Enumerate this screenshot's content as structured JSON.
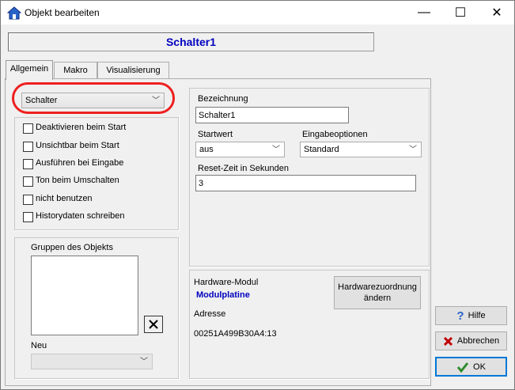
{
  "window": {
    "title": "Objekt bearbeiten"
  },
  "titlebar_buttons": {
    "minimize": "—",
    "maximize": "☐",
    "close": "✕"
  },
  "object_name": "Schalter1",
  "tabs": [
    {
      "label": "Allgemein",
      "active": true
    },
    {
      "label": "Makro",
      "active": false
    },
    {
      "label": "Visualisierung",
      "active": false
    }
  ],
  "type_select": {
    "value": "Schalter"
  },
  "checkboxes": [
    {
      "label": "Deaktivieren beim Start",
      "checked": false
    },
    {
      "label": "Unsichtbar beim Start",
      "checked": false
    },
    {
      "label": "Ausführen bei Eingabe",
      "checked": false
    },
    {
      "label": "Ton beim Umschalten",
      "checked": false
    },
    {
      "label": "nicht benutzen",
      "checked": false
    },
    {
      "label": "Historydaten schreiben",
      "checked": false
    }
  ],
  "groups": {
    "label": "Gruppen des Objekts",
    "new_label": "Neu",
    "new_value": ""
  },
  "bezeichnung": {
    "label": "Bezeichnung",
    "value": "Schalter1"
  },
  "startwert": {
    "label": "Startwert",
    "value": "aus"
  },
  "eingabeoptionen": {
    "label": "Eingabeoptionen",
    "value": "Standard"
  },
  "reset_zeit": {
    "label": "Reset-Zeit in Sekunden",
    "value": "3"
  },
  "hardware": {
    "modul_label": "Hardware-Modul",
    "modul_value": "Modulplatine",
    "adresse_label": "Adresse",
    "adresse_value": "00251A499B30A4:13",
    "assign_button_line1": "Hardwarezuordnung",
    "assign_button_line2": "ändern"
  },
  "buttons": {
    "help": "Hilfe",
    "cancel": "Abbrechen",
    "ok": "OK"
  },
  "colors": {
    "accent_blue": "#0000c0",
    "highlight_red": "#ee2020"
  }
}
